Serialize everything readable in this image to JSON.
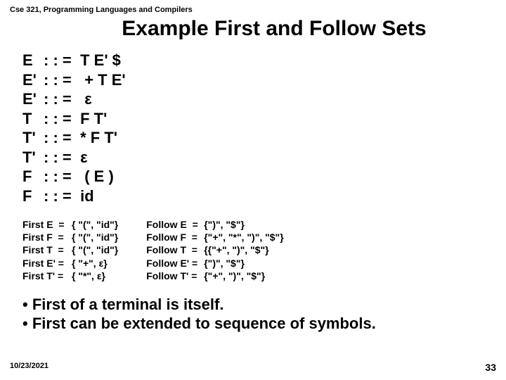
{
  "course_label": "Cse 321, Programming Languages and Compilers",
  "title": "Example First and Follow Sets",
  "grammar": [
    {
      "lhs": "E",
      "op": ": : =",
      "rhs": " T E' $"
    },
    {
      "lhs": "E'",
      "op": ": : =",
      "rhs": "  + T E'"
    },
    {
      "lhs": "E'",
      "op": ": : =",
      "rhs": "  ε"
    },
    {
      "lhs": "T",
      "op": ": : =",
      "rhs": " F T'"
    },
    {
      "lhs": "T'",
      "op": ": : =",
      "rhs": " * F T'"
    },
    {
      "lhs": "T'",
      "op": ": : =",
      "rhs": " ε"
    },
    {
      "lhs": "F",
      "op": ": : =",
      "rhs": "  ( E )"
    },
    {
      "lhs": "F",
      "op": ": : =",
      "rhs": " id"
    }
  ],
  "first_sets": [
    {
      "label": "First E  = ",
      "value": "{ \"(\", \"id\"}"
    },
    {
      "label": "First F  = ",
      "value": "{ \"(\", \"id\"}"
    },
    {
      "label": "First T  = ",
      "value": "{ \"(\", \"id\"}"
    },
    {
      "label": "First E' = ",
      "value": "{ \"+\", ε}"
    },
    {
      "label": "First T' = ",
      "value": "{ \"*\", ε}"
    }
  ],
  "follow_sets": [
    {
      "label": "Follow E  = ",
      "value": "{\")\", \"$\"}"
    },
    {
      "label": "Follow F  = ",
      "value": "{\"+\", \"*\", \")\", \"$\"}"
    },
    {
      "label": "Follow T  = ",
      "value": "{{\"+\", \")\", \"$\"}"
    },
    {
      "label": "Follow E' = ",
      "value": "{\")\", \"$\"}"
    },
    {
      "label": "Follow T' = ",
      "value": "{\"+\", \")\", \"$\"}"
    }
  ],
  "bullets": [
    "•  First of a terminal is itself.",
    "•  First can be extended to sequence of symbols."
  ],
  "footer_date": "10/23/2021",
  "footer_page": "33"
}
